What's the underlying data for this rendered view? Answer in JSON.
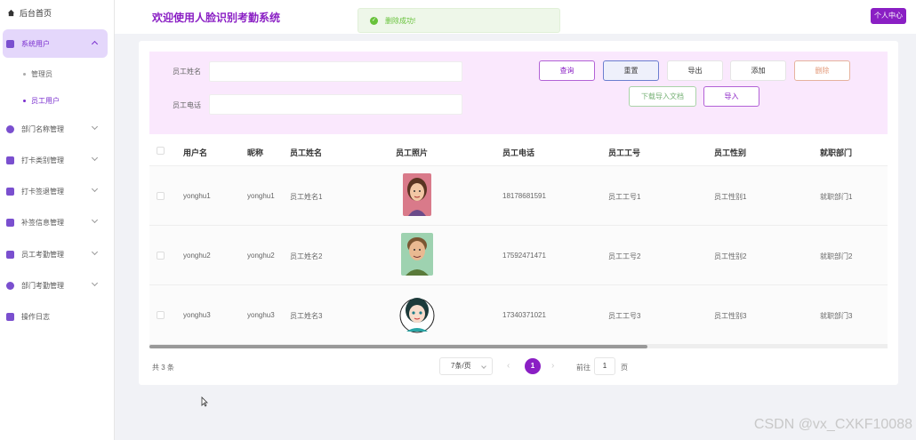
{
  "sidebar": {
    "home": "后台首页",
    "items": [
      {
        "label": "系统用户"
      },
      {
        "label": "部门名称管理"
      },
      {
        "label": "打卡类别管理"
      },
      {
        "label": "打卡签退管理"
      },
      {
        "label": "补签信息管理"
      },
      {
        "label": "员工考勤管理"
      },
      {
        "label": "部门考勤管理"
      },
      {
        "label": "操作日志"
      }
    ],
    "sub_items": [
      {
        "label": "管理员"
      },
      {
        "label": "员工用户"
      }
    ]
  },
  "header": {
    "title": "欢迎使用人脸识别考勤系统",
    "toast": "删除成功!",
    "profile": "个人中心"
  },
  "filter": {
    "name_label": "员工姓名",
    "phone_label": "员工电话",
    "buttons": {
      "query": "查询",
      "reset": "重置",
      "export": "导出",
      "add": "添加",
      "delete": "删除",
      "template": "下载导入文档",
      "import": "导入"
    }
  },
  "table": {
    "columns": [
      "用户名",
      "昵称",
      "员工姓名",
      "员工照片",
      "员工电话",
      "员工工号",
      "员工性别",
      "就职部门"
    ],
    "rows": [
      {
        "username": "yonghu1",
        "nickname": "yonghu1",
        "name": "员工姓名1",
        "photo": "female-avatar",
        "phone": "18178681591",
        "job_no": "员工工号1",
        "gender": "员工性别1",
        "dept": "就职部门1"
      },
      {
        "username": "yonghu2",
        "nickname": "yonghu2",
        "name": "员工姓名2",
        "photo": "male-avatar",
        "phone": "17592471471",
        "job_no": "员工工号2",
        "gender": "员工性别2",
        "dept": "就职部门2"
      },
      {
        "username": "yonghu3",
        "nickname": "yonghu3",
        "name": "员工姓名3",
        "photo": "female-cartoon-avatar",
        "phone": "17340371021",
        "job_no": "员工工号3",
        "gender": "员工性别3",
        "dept": "就职部门3"
      }
    ]
  },
  "pagination": {
    "total": "共 3 条",
    "page_size": "7条/页",
    "current_page": "1",
    "goto_prefix": "前往",
    "goto_value": "1",
    "goto_suffix": "页"
  },
  "watermark": "CSDN @vx_CXKF10088",
  "colors": {
    "accent": "#8a1fc4",
    "filter_bg": "#fae8fd",
    "success": "#67c23a"
  }
}
